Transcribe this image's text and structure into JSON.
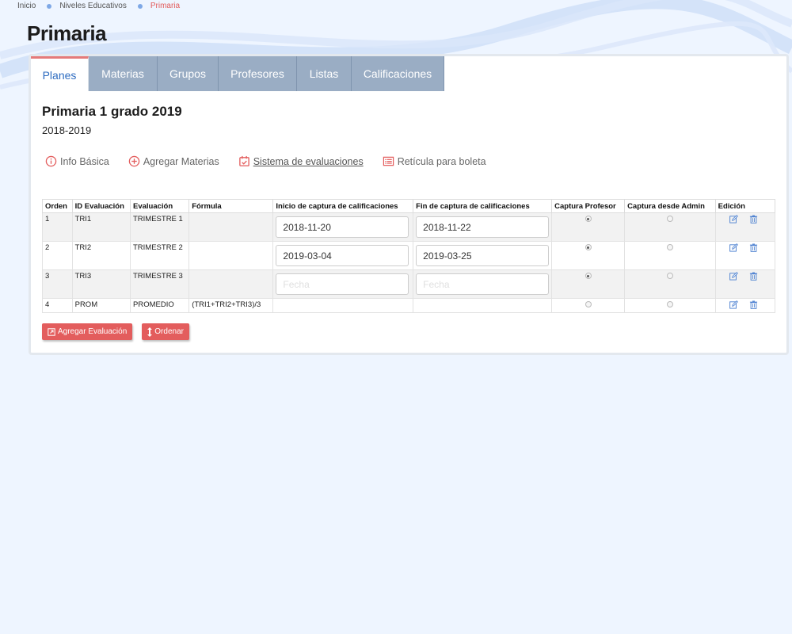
{
  "breadcrumb": {
    "items": [
      "Inicio",
      "Niveles Educativos",
      "Primaria"
    ]
  },
  "page_title": "Primaria",
  "tabs": [
    "Planes",
    "Materias",
    "Grupos",
    "Profesores",
    "Listas",
    "Calificaciones"
  ],
  "plan": {
    "title": "Primaria 1 grado 2019",
    "year": "2018-2019"
  },
  "subnav": [
    {
      "label": "Info Básica",
      "icon": "info-icon"
    },
    {
      "label": "Agregar Materias",
      "icon": "plus-circle-icon"
    },
    {
      "label": "Sistema de evaluaciones",
      "icon": "calendar-check-icon"
    },
    {
      "label": "Retícula para boleta",
      "icon": "list-icon"
    }
  ],
  "table": {
    "headers": [
      "Orden",
      "ID Evaluación",
      "Evaluación",
      "Fórmula",
      "Inicio de captura de calificaciones",
      "Fin de captura de calificaciones",
      "Captura Profesor",
      "Captura desde Admin",
      "Edición"
    ],
    "date_placeholder": "Fecha",
    "rows": [
      {
        "orden": "1",
        "id": "TRI1",
        "evaluacion": "TRIMESTRE 1",
        "formula": "",
        "inicio": "2018-11-20",
        "fin": "2018-11-22",
        "captura_profesor": true,
        "captura_admin": false,
        "has_dates": true
      },
      {
        "orden": "2",
        "id": "TRI2",
        "evaluacion": "TRIMESTRE 2",
        "formula": "",
        "inicio": "2019-03-04",
        "fin": "2019-03-25",
        "captura_profesor": true,
        "captura_admin": false,
        "has_dates": true
      },
      {
        "orden": "3",
        "id": "TRI3",
        "evaluacion": "TRIMESTRE 3",
        "formula": "",
        "inicio": "",
        "fin": "",
        "captura_profesor": true,
        "captura_admin": false,
        "has_dates": true
      },
      {
        "orden": "4",
        "id": "PROM",
        "evaluacion": "PROMEDIO",
        "formula": "(TRI1+TRI2+TRI3)/3",
        "inicio": "",
        "fin": "",
        "captura_profesor": false,
        "captura_admin": false,
        "has_dates": false
      }
    ]
  },
  "buttons": {
    "add_evaluation": "Agregar Evaluación",
    "sort": "Ordenar"
  },
  "colors": {
    "accent": "#e35d5d",
    "tab_bg": "#9aadc4",
    "tab_active_text": "#2e6cc0",
    "icon_blue": "#4a7fd0",
    "page_bg": "#eef5ff"
  }
}
